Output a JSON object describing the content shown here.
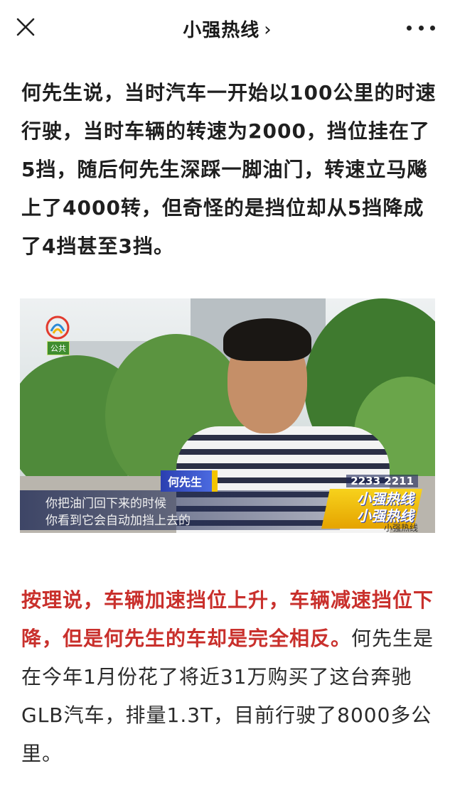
{
  "header": {
    "title": "小强热线",
    "chevron": "›",
    "close_icon": "close-icon",
    "more_icon": "more-icon"
  },
  "article": {
    "paragraph1": "何先生说，当时汽车一开始以100公里的时速行驶，当时车辆的转速为2000，挡位挂在了5挡，随后何先生深踩一脚油门，转速立马飚上了4000转，但奇怪的是挡位却从5挡降成了4挡甚至3挡。",
    "paragraph2_red": "按理说，车辆加速挡位上升，车辆减速挡位下降，但是何先生的车却是完全相反。",
    "paragraph2_rest": "何先生是在今年1月份花了将近31万购买了这台奔驰GLB汽车，排量1.3T，目前行驶了8000多公里。"
  },
  "video_frame": {
    "name_tag": "何先生",
    "subtitle_line1": "你把油门回下来的时候",
    "subtitle_line2": "你看到它会自动加挡上去的",
    "hotline_number": "2233 2211",
    "show_logo_line1": "小强热线",
    "show_logo_line2": "小强热线",
    "show_logo_sub": "小强热线",
    "channel_badge": "公共"
  },
  "colors": {
    "accent_red": "#c9302c",
    "name_tag_blue": "#2b3fb0",
    "logo_yellow": "#f2c400"
  }
}
